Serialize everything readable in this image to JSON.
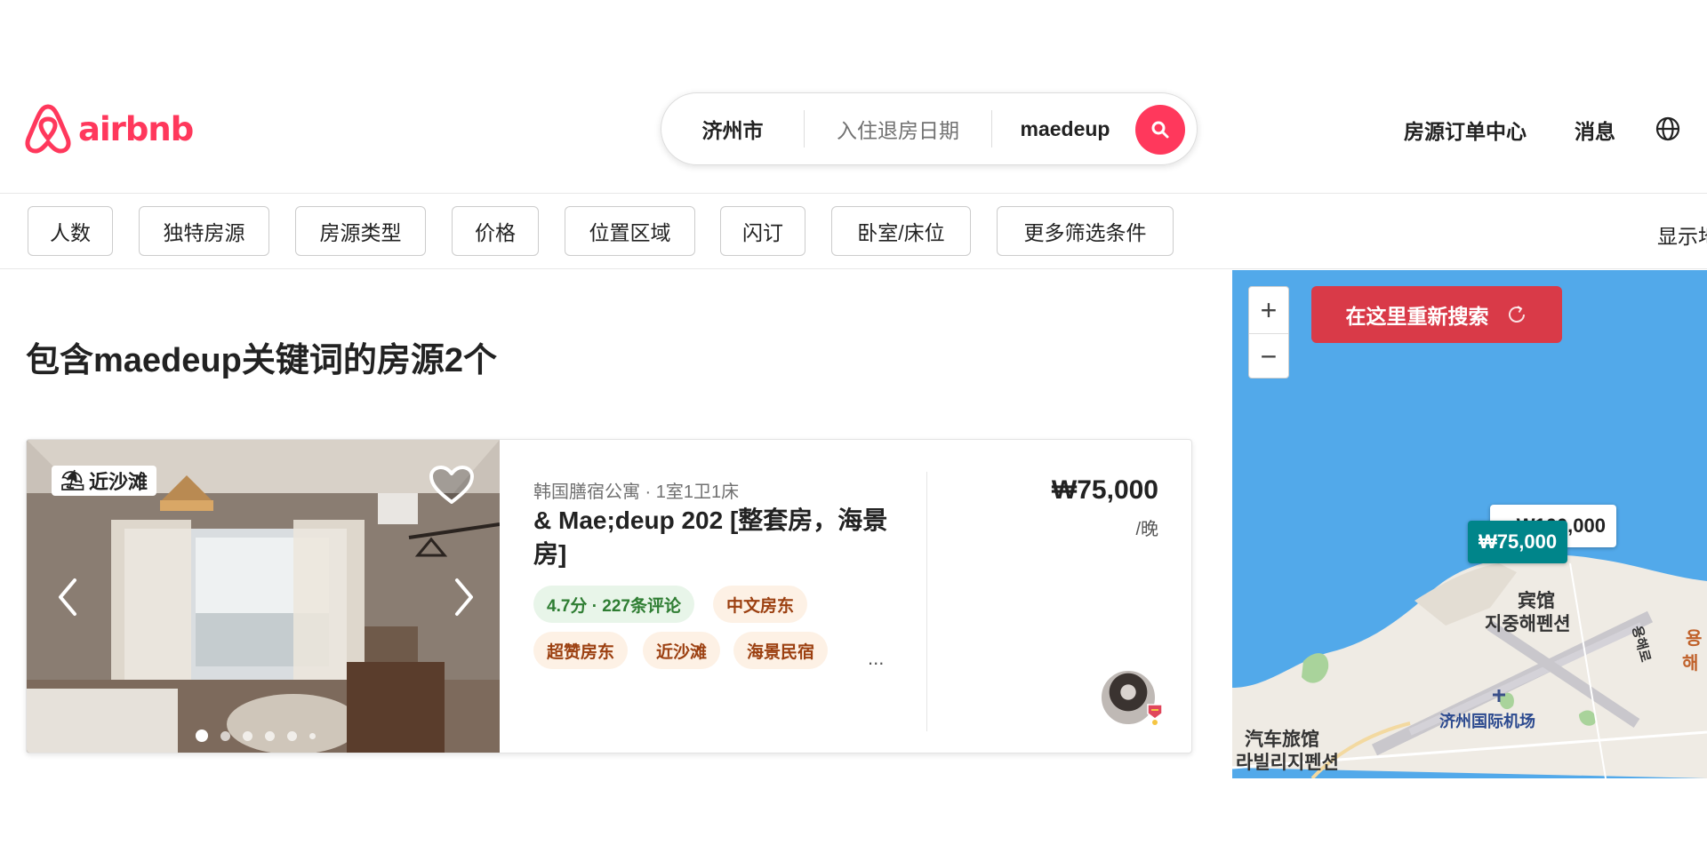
{
  "brand": {
    "name": "airbnb",
    "color": "#ff385c"
  },
  "search": {
    "location": "济州市",
    "dates_placeholder": "入住退房日期",
    "keyword": "maedeup",
    "icon": "search-icon"
  },
  "nav": {
    "host_center": "房源订单中心",
    "messages": "消息",
    "language_icon": "globe-icon"
  },
  "filters": [
    "人数",
    "独特房源",
    "房源类型",
    "价格",
    "位置区域",
    "闪订",
    "卧室/床位",
    "更多筛选条件"
  ],
  "show_map": "显示地",
  "results": {
    "title": "包含maedeup关键词的房源2个",
    "listings": [
      {
        "photo_badge": "近沙滩",
        "subtitle": "韩国膳宿公寓 · 1室1卫1床",
        "title": "& Mae;deup 202 [整套房，海景房]",
        "tags": [
          "4.7分 · 227条评论",
          "中文房东",
          "超赞房东",
          "近沙滩",
          "海景民宿"
        ],
        "more": "...",
        "price": "₩75,000",
        "per": "/晚",
        "photo_count": 6,
        "active_photo": 1
      }
    ]
  },
  "map": {
    "zoom_in": "+",
    "zoom_out": "−",
    "research_label": "在这里重新搜索",
    "pins": [
      "₩100,000",
      "₩75,000"
    ],
    "labels": [
      "宾馆",
      "지중해펜션",
      "济州国际机场",
      "汽车旅馆",
      "라빌리지펜션",
      "용해로",
      "해",
      "용"
    ],
    "water_color": "#52a9ea",
    "land_color": "#efebe4",
    "pin_color": "#00858a",
    "button_color": "#d93a48"
  }
}
